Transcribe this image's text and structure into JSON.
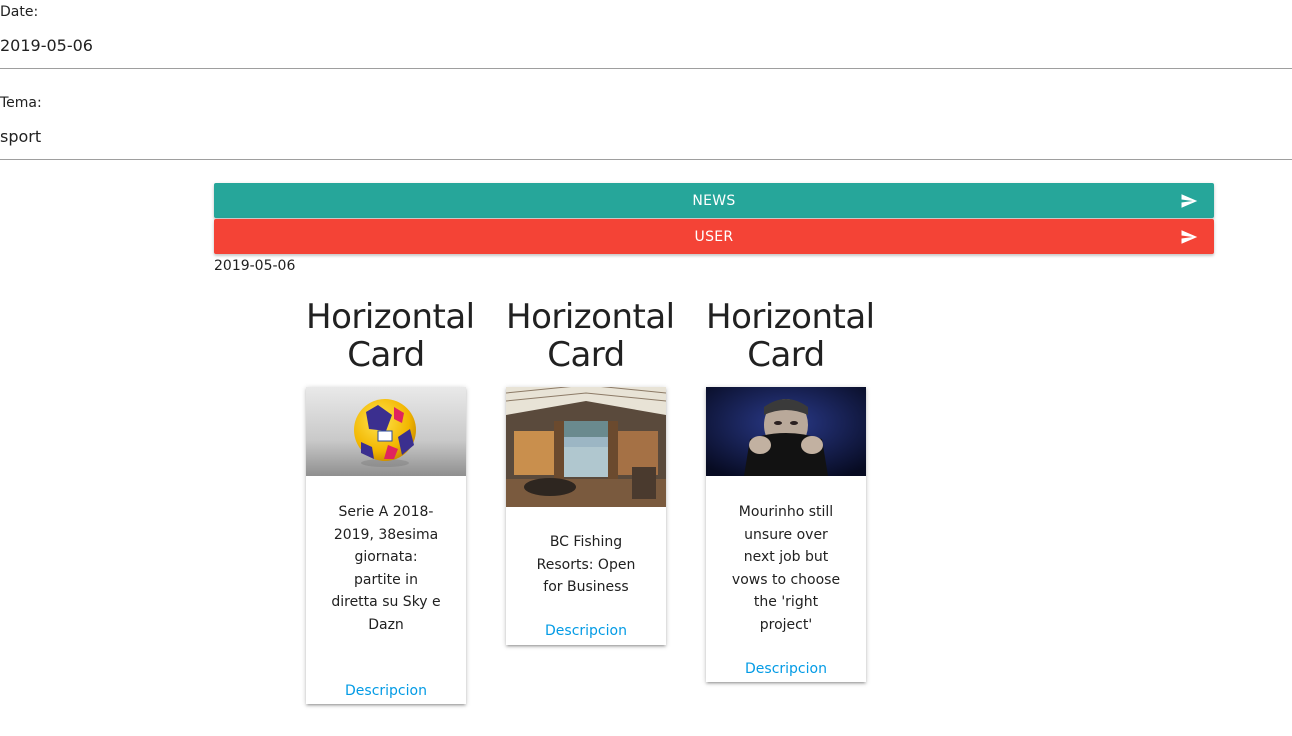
{
  "form": {
    "date_label": "Date:",
    "date_value": "2019-05-06",
    "tema_label": "Tema:",
    "tema_value": "sport"
  },
  "buttons": {
    "news_label": "NEWS",
    "user_label": "USER"
  },
  "colors": {
    "news": "#26a69a",
    "user": "#f44336",
    "link": "#039be5"
  },
  "current_date": "2019-05-06",
  "cards": [
    {
      "heading": "Horizontal Card",
      "title": "Serie A 2018-2019, 38esima giornata: partite in diretta su Sky e Dazn",
      "action": "Descripcion"
    },
    {
      "heading": "Horizontal Card",
      "title": "BC Fishing Resorts: Open for Business",
      "action": "Descripcion"
    },
    {
      "heading": "Horizontal Card",
      "title": "Mourinho still unsure over next job but vows to choose the 'right project'",
      "action": "Descripcion"
    }
  ]
}
